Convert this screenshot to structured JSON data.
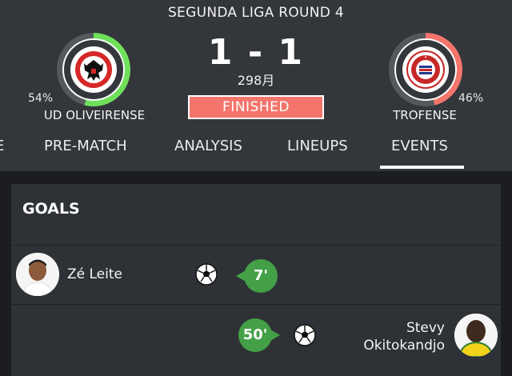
{
  "header": {
    "round_title": "SEGUNDA LIGA ROUND 4",
    "score": "1 - 1",
    "date": "298月",
    "status": "FINISHED",
    "status_color": "#f4756b"
  },
  "home_team": {
    "name": "UD OLIVEIRENSE",
    "percent_label": "54%",
    "percent_value": 54,
    "ring_color": "#6ee05a",
    "crest_icon": "oliveirense-crest-icon"
  },
  "away_team": {
    "name": "TROFENSE",
    "percent_label": "46%",
    "percent_value": 46,
    "ring_color": "#f4756b",
    "crest_icon": "trofense-crest-icon"
  },
  "tabs": [
    {
      "label": "E"
    },
    {
      "label": "PRE-MATCH"
    },
    {
      "label": "ANALYSIS"
    },
    {
      "label": "LINEUPS"
    },
    {
      "label": "EVENTS",
      "active": true
    }
  ],
  "goals": {
    "title": "GOALS",
    "events": [
      {
        "side": "home",
        "player_name": "Zé Leite",
        "minute": "7'",
        "icon": "soccer-ball-icon"
      },
      {
        "side": "away",
        "player_name_line1": "Stevy",
        "player_name_line2": "Okitokandjo",
        "minute": "50'",
        "icon": "soccer-ball-icon"
      }
    ]
  },
  "colors": {
    "header_bg": "#33363b",
    "page_bg": "#1b1d20",
    "card_bg": "#2e3135",
    "minute_badge": "#43a047"
  }
}
